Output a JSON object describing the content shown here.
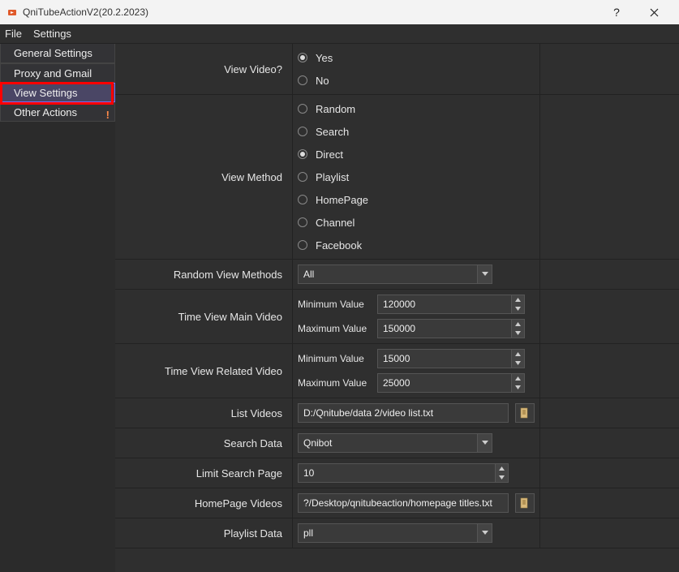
{
  "window": {
    "title": "QniTubeActionV2(20.2.2023)"
  },
  "menu": {
    "file": "File",
    "settings": "Settings"
  },
  "sidebar": {
    "items": [
      {
        "label": "General Settings"
      },
      {
        "label": "Proxy and Gmail"
      },
      {
        "label": "View Settings"
      },
      {
        "label": "Other Actions"
      }
    ]
  },
  "form": {
    "view_video": {
      "label": "View Video?",
      "options": {
        "yes": "Yes",
        "no": "No"
      },
      "selected": "yes"
    },
    "view_method": {
      "label": "View Method",
      "options": {
        "random": "Random",
        "search": "Search",
        "direct": "Direct",
        "playlist": "Playlist",
        "homepage": "HomePage",
        "channel": "Channel",
        "facebook": "Facebook"
      },
      "selected": "direct"
    },
    "random_view_methods": {
      "label": "Random View Methods",
      "value": "All"
    },
    "time_main": {
      "label": "Time View Main Video",
      "min_label": "Minimum Value",
      "max_label": "Maximum Value",
      "min": "120000",
      "max": "150000"
    },
    "time_related": {
      "label": "Time View Related Video",
      "min_label": "Minimum Value",
      "max_label": "Maximum Value",
      "min": "15000",
      "max": "25000"
    },
    "list_videos": {
      "label": "List Videos",
      "value": "D:/Qnitube/data 2/video list.txt"
    },
    "search_data": {
      "label": "Search Data",
      "value": "Qnibot"
    },
    "limit_search_page": {
      "label": "Limit Search Page",
      "value": "10"
    },
    "homepage_videos": {
      "label": "HomePage Videos",
      "value": "?/Desktop/qnitubeaction/homepage titles.txt"
    },
    "playlist_data": {
      "label": "Playlist Data",
      "value": "pll"
    }
  }
}
